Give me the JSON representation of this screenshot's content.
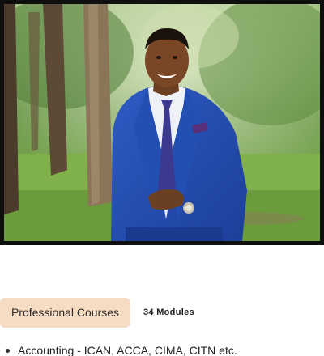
{
  "course": {
    "badge_label": "Professional Courses",
    "modules_label": "34  Modules"
  },
  "course_list": {
    "items": [
      {
        "label": "Accounting - ICAN, ACCA, CIMA, CITN etc."
      }
    ]
  },
  "colors": {
    "badge_background": "#f7dcc4",
    "photo_border": "#0f0f0f",
    "text": "#222222"
  },
  "icons": {
    "list_bullet": "bullet-icon"
  }
}
